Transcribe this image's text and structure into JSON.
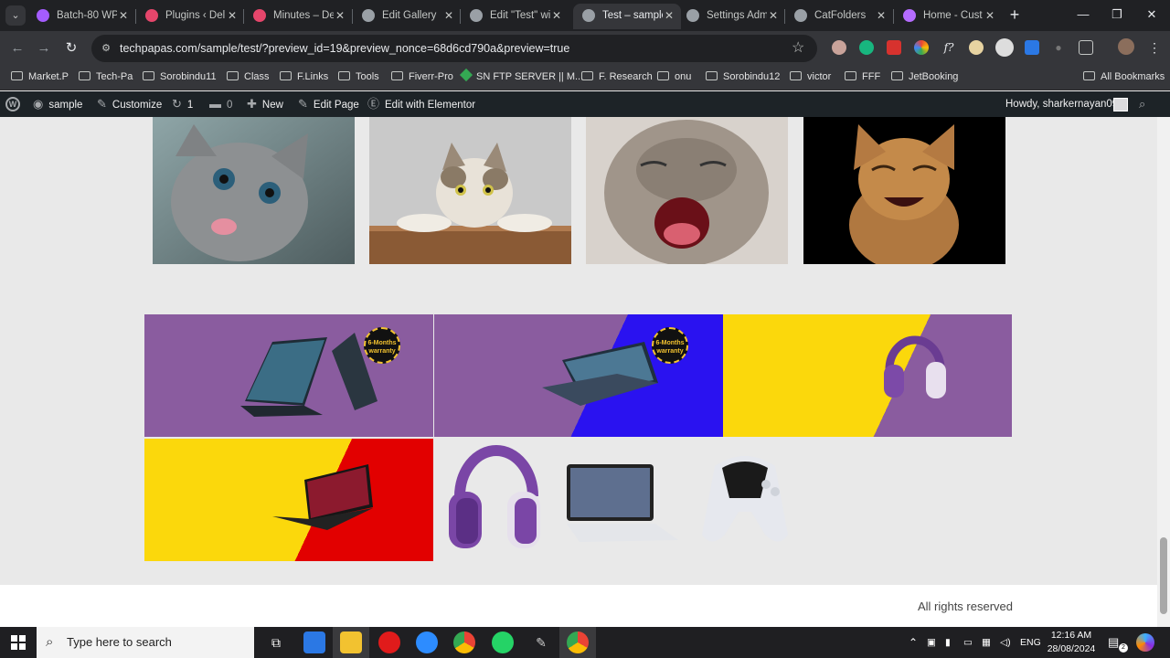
{
  "browser": {
    "tabs": [
      {
        "title": "Batch-80 WP",
        "icon": "messenger-icon",
        "color": "#a45cff"
      },
      {
        "title": "Plugins ‹ Deli",
        "icon": "wordpress-site-icon",
        "color": "#e5466b"
      },
      {
        "title": "Minutes – De",
        "icon": "wordpress-site-icon",
        "color": "#e5466b"
      },
      {
        "title": "Edit Gallery",
        "icon": "globe-icon",
        "color": "#9aa0a6"
      },
      {
        "title": "Edit \"Test\" wi",
        "icon": "globe-icon",
        "color": "#9aa0a6"
      },
      {
        "title": "Test – sample",
        "icon": "globe-icon",
        "color": "#9aa0a6",
        "active": true
      },
      {
        "title": "Settings Adm",
        "icon": "globe-icon",
        "color": "#9aa0a6"
      },
      {
        "title": "CatFolders",
        "icon": "globe-icon",
        "color": "#9aa0a6"
      },
      {
        "title": "Home - Cust",
        "icon": "p-icon",
        "color": "#b56cff"
      }
    ],
    "url": "techpapas.com/sample/test/?preview_id=19&preview_nonce=68d6cd790a&preview=true",
    "bookmarks": [
      {
        "label": "Market.P",
        "type": "folder"
      },
      {
        "label": "Tech-Pa",
        "type": "folder"
      },
      {
        "label": "Sorobindu11",
        "type": "folder"
      },
      {
        "label": "Class",
        "type": "folder"
      },
      {
        "label": "F.Links",
        "type": "folder"
      },
      {
        "label": "Tools",
        "type": "folder"
      },
      {
        "label": "Fiverr-Pro",
        "type": "folder"
      },
      {
        "label": "SN FTP SERVER || M...",
        "type": "site"
      },
      {
        "label": "F. Research",
        "type": "folder"
      },
      {
        "label": "onu",
        "type": "folder"
      },
      {
        "label": "Sorobindu12",
        "type": "folder"
      },
      {
        "label": "victor",
        "type": "folder"
      },
      {
        "label": "FFF",
        "type": "folder"
      },
      {
        "label": "JetBooking",
        "type": "folder"
      }
    ],
    "all_bookmarks": "All Bookmarks"
  },
  "adminbar": {
    "site": "sample",
    "customize": "Customize",
    "updates": "1",
    "comments": "0",
    "new": "New",
    "edit_page": "Edit Page",
    "edit_elementor": "Edit with Elementor",
    "howdy": "Howdy, sharkernayan09"
  },
  "page": {
    "cats": [
      {
        "name": "gray-kitten-tongue"
      },
      {
        "name": "surprised-white-cat"
      },
      {
        "name": "yawning-tabby-cat"
      },
      {
        "name": "laughing-kitten"
      }
    ],
    "banners": [
      {
        "name": "gaming-laptop-banner",
        "badge": "6-Months warranty"
      },
      {
        "name": "laptop-blue-banner",
        "badge": "6-Months warranty"
      },
      {
        "name": "headphones-banner"
      },
      {
        "name": "laptop-red-banner"
      }
    ],
    "products": [
      "purple-headphones",
      "tablet-with-keyboard",
      "game-controller"
    ],
    "footer": "All rights reserved"
  },
  "taskbar": {
    "search_placeholder": "Type here to search",
    "lang": "ENG",
    "time": "12:16 AM",
    "date": "28/08/2024",
    "notification_count": "2"
  },
  "colors": {
    "purple": "#8a5c9f",
    "yellow": "#fbd80c",
    "blue": "#2a12f0",
    "red": "#e20000"
  }
}
